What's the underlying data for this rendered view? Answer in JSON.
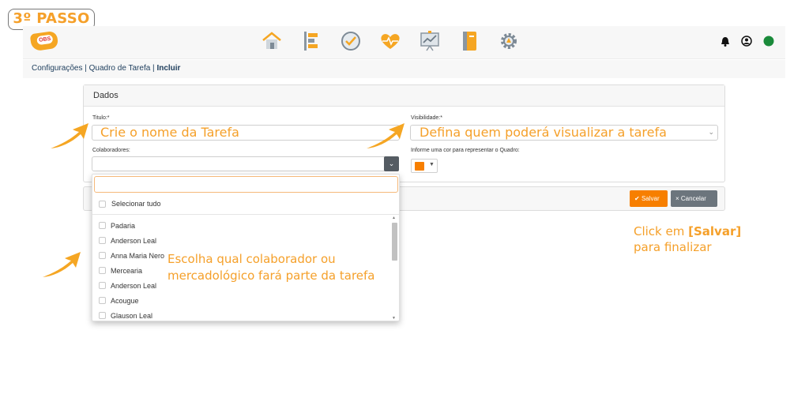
{
  "step_badge": "3º PASSO",
  "nav": {
    "logo_text": "OBS",
    "icons": [
      "home-icon",
      "tasks-icon",
      "check-icon",
      "heart-pulse-icon",
      "chart-board-icon",
      "notebook-icon",
      "gear-icon"
    ],
    "right_icons": [
      "bell-icon",
      "user-icon",
      "status-dot-icon"
    ],
    "status_color": "#1a8a3a"
  },
  "breadcrumb": {
    "part1": "Configurações | Quadro de Tarefa | ",
    "current": "Incluir"
  },
  "form": {
    "section_title": "Dados",
    "titulo_label": "Titulo:*",
    "visibilidade_label": "Visibilidade:*",
    "colaboradores_label": "Colaboradores:",
    "cor_label": "Informe uma cor para representar o Quadro:",
    "selected_color": "#f77f00"
  },
  "buttons": {
    "save": "Salvar",
    "cancel": "Cancelar"
  },
  "dropdown": {
    "select_all": "Selecionar tudo",
    "items": [
      "Padaria",
      "Anderson Leal",
      "Anna Maria Nero",
      "Mercearia",
      "Anderson Leal",
      "Acougue",
      "Glauson Leal"
    ]
  },
  "annotations": {
    "titulo_hint": "Crie o nome da Tarefa",
    "visibilidade_hint": "Defina quem poderá visualizar a tarefa",
    "colaborador_hint_line1": "Escolha qual colaborador ou",
    "colaborador_hint_line2": "mercadológico fará parte da tarefa",
    "salvar_hint_prefix": "Click em ",
    "salvar_hint_bold": "[Salvar]",
    "salvar_hint_line2": "para finalizar",
    "accent_color": "#f5a02a"
  }
}
